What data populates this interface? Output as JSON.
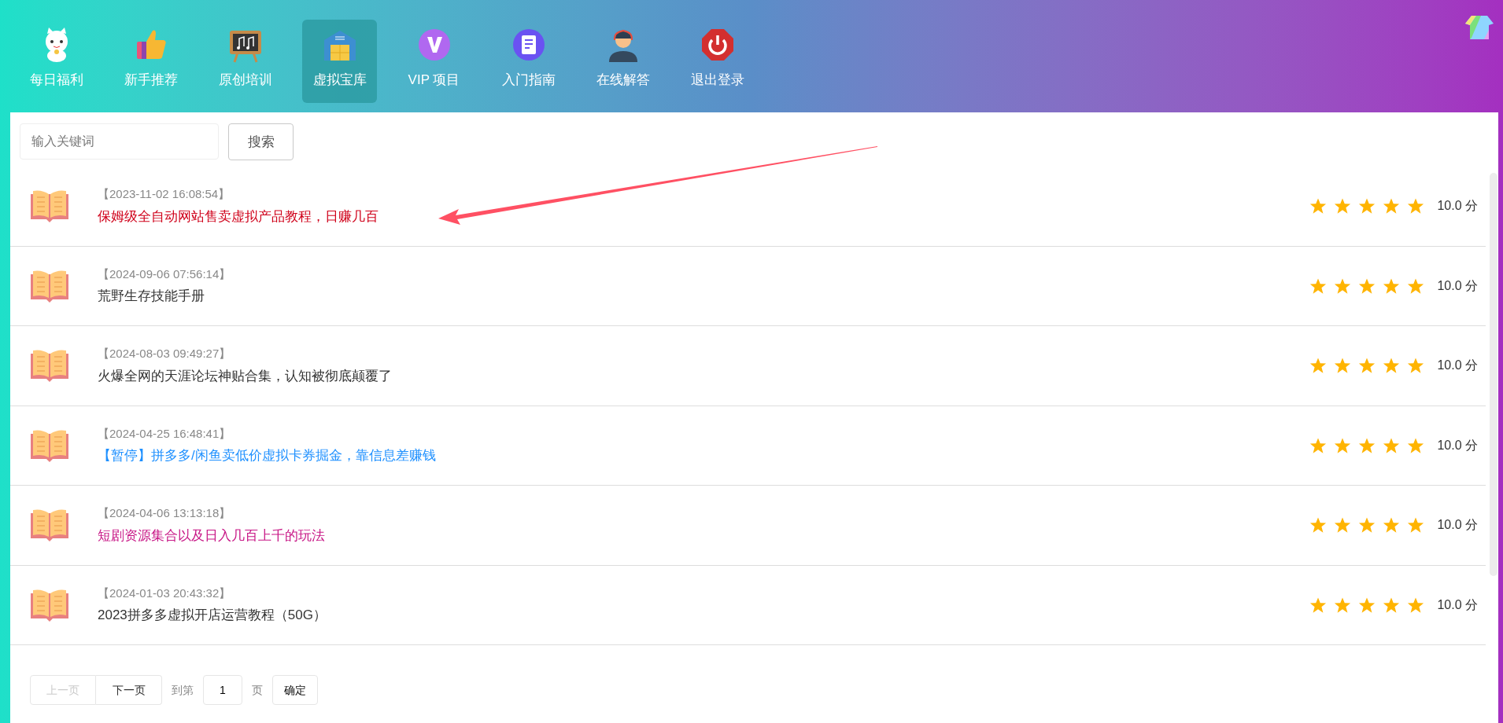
{
  "nav": [
    {
      "label": "每日福利",
      "selected": false
    },
    {
      "label": "新手推荐",
      "selected": false
    },
    {
      "label": "原创培训",
      "selected": false
    },
    {
      "label": "虚拟宝库",
      "selected": true
    },
    {
      "label": "VIP 项目",
      "selected": false
    },
    {
      "label": "入门指南",
      "selected": false
    },
    {
      "label": "在线解答",
      "selected": false
    },
    {
      "label": "退出登录",
      "selected": false
    }
  ],
  "search": {
    "placeholder": "输入关键词",
    "button": "搜索"
  },
  "items": [
    {
      "date": "【2023-11-02 16:08:54】",
      "title": "保姆级全自动网站售卖虚拟产品教程，日赚几百",
      "color": "#d0021b",
      "stars": 5,
      "score": "10.0 分"
    },
    {
      "date": "【2024-09-06 07:56:14】",
      "title": "荒野生存技能手册",
      "color": "#333333",
      "stars": 5,
      "score": "10.0 分"
    },
    {
      "date": "【2024-08-03 09:49:27】",
      "title": "火爆全网的天涯论坛神贴合集，认知被彻底颠覆了",
      "color": "#333333",
      "stars": 5,
      "score": "10.0 分"
    },
    {
      "date": "【2024-04-25 16:48:41】",
      "title": "【暂停】拼多多/闲鱼卖低价虚拟卡券掘金，靠信息差赚钱",
      "color": "#1e90ff",
      "stars": 5,
      "score": "10.0 分"
    },
    {
      "date": "【2024-04-06 13:13:18】",
      "title": "短剧资源集合以及日入几百上千的玩法",
      "color": "#c71585",
      "stars": 5,
      "score": "10.0 分"
    },
    {
      "date": "【2024-01-03 20:43:32】",
      "title": "2023拼多多虚拟开店运营教程（50G）",
      "color": "#333333",
      "stars": 5,
      "score": "10.0 分"
    }
  ],
  "pagination": {
    "prev": {
      "label": "上一页",
      "disabled": true
    },
    "next": {
      "label": "下一页",
      "disabled": false
    },
    "goto": "到第",
    "page": "1",
    "unit": "页",
    "confirm": "确定"
  }
}
